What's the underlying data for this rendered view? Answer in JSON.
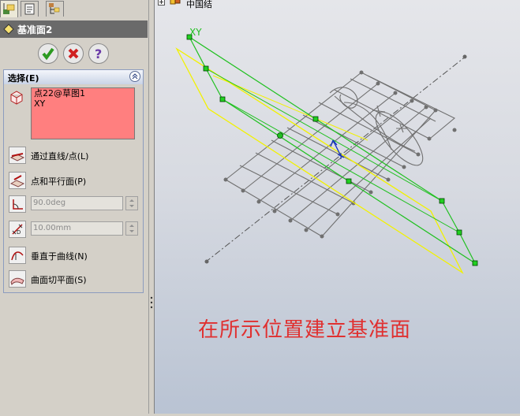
{
  "panel": {
    "tab_icons": [
      "feature-manager-icon",
      "property-manager-icon",
      "configuration-manager-icon"
    ],
    "title": "基准面2",
    "buttons": {
      "ok": "ok-check-icon",
      "cancel": "cancel-x-icon",
      "help": "help-question-icon"
    },
    "selection_group": {
      "header": "选择(E)",
      "items": [
        "点22@草图1",
        "XY"
      ],
      "options": [
        {
          "label": "通过直线/点(L)",
          "icon": "through-line-point-icon"
        },
        {
          "label": "点和平行面(P)",
          "icon": "parallel-plane-point-icon"
        },
        {
          "angle_value": "90.0deg",
          "icon": "angle-icon"
        },
        {
          "distance_value": "10.00mm",
          "icon": "distance-icon"
        },
        {
          "label": "垂直于曲线(N)",
          "icon": "normal-to-curve-icon"
        },
        {
          "label": "曲面切平面(S)",
          "icon": "on-surface-icon"
        }
      ]
    }
  },
  "viewport": {
    "tree_label": "中国结",
    "plane_label": "XY",
    "caption": "在所示位置建立基准面",
    "colors": {
      "new_plane": "#ffff00",
      "preview_plane": "#00c000",
      "sketch_grid": "#707070",
      "caption": "#e03030"
    }
  }
}
